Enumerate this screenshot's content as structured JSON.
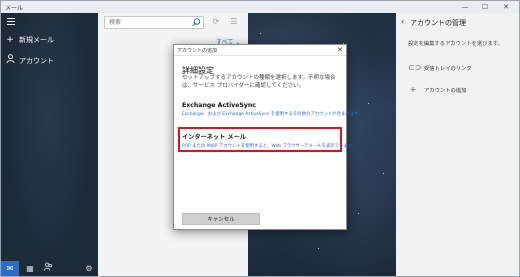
{
  "app": {
    "title": "メール",
    "window_controls": [
      "—",
      "☐",
      "✕"
    ]
  },
  "left_nav": {
    "items": [
      {
        "icon": "+",
        "label": "新規メール"
      },
      {
        "icon": "person-icon",
        "label": "アカウント"
      }
    ],
    "bottom_icons": [
      "mail-icon",
      "calendar-icon",
      "people-icon",
      "settings-icon"
    ]
  },
  "list_pane": {
    "search_placeholder": "検索",
    "filter_label": "すべて ⌄"
  },
  "right_pane": {
    "title": "アカウントの管理",
    "description": "設定を編集するアカウントを選びます。",
    "items": [
      {
        "icon": "link-icon",
        "label": "受信トレイのリンク"
      },
      {
        "icon": "+",
        "label": "アカウントの追加"
      }
    ]
  },
  "dialog": {
    "title": "アカウントの追加",
    "heading": "詳細設定",
    "description": "セットアップするアカウントの種類を選択します。不明な場合は、サービス プロバイダーに確認してください。",
    "options": [
      {
        "name": "Exchange ActiveSync",
        "sub": "Exchange、および Exchange ActiveSync を使用するその他のアカウントが含まれます。"
      },
      {
        "name": "インターネット メール",
        "sub": "POP または IMAP アカウントを使用すると、Web ブラウザーでメールを表示できます。"
      }
    ],
    "cancel_label": "キャンセル"
  },
  "colors": {
    "accent": "#2b6cc4",
    "highlight_border": "#d0181e"
  }
}
